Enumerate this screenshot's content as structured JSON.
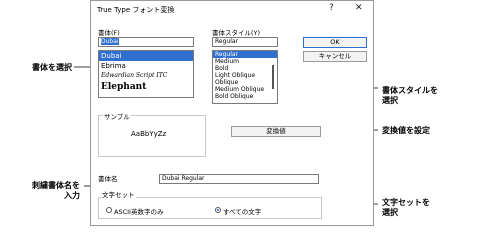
{
  "dialog": {
    "title": "True Type フォント変換",
    "help_glyph": "?",
    "close_glyph": "✕",
    "font_label": "書体(F)",
    "font_input": "Dubai",
    "font_list": [
      {
        "label": "Dubai",
        "selected": true
      },
      {
        "label": "Ebrima",
        "selected": false
      },
      {
        "label": "Edwardian Script ITC",
        "selected": false
      },
      {
        "label": "Elephant",
        "selected": false
      }
    ],
    "style_label": "書体スタイル(Y)",
    "style_input": "Regular",
    "style_list": [
      {
        "label": "Regular",
        "selected": true
      },
      {
        "label": "Medium",
        "selected": false
      },
      {
        "label": "Bold",
        "selected": false
      },
      {
        "label": "Light Oblique",
        "selected": false
      },
      {
        "label": "Oblique",
        "selected": false
      },
      {
        "label": "Medium Oblique",
        "selected": false
      },
      {
        "label": "Bold Oblique",
        "selected": false
      }
    ],
    "ok_label": "OK",
    "cancel_label": "キャンセル",
    "sample_group": "サンプル",
    "sample_text": "AaBbYyZz",
    "convert_label": "変換値",
    "name_label": "書体名",
    "name_value": "Dubai Regular",
    "charset_group": "文字セット",
    "charset_options": [
      {
        "label": "ASCII英数字のみ",
        "checked": false
      },
      {
        "label": "すべての文字",
        "checked": true
      }
    ]
  },
  "callouts": {
    "select_font": "書体を選択",
    "select_style": "書体スタイルを\n選択",
    "set_convert": "変換値を設定",
    "enter_name": "刺繍書体名を\n入力",
    "select_charset": "文字セットを\n選択"
  },
  "colors": {
    "selection": "#2f6fd0",
    "border": "#7a7a7a"
  }
}
